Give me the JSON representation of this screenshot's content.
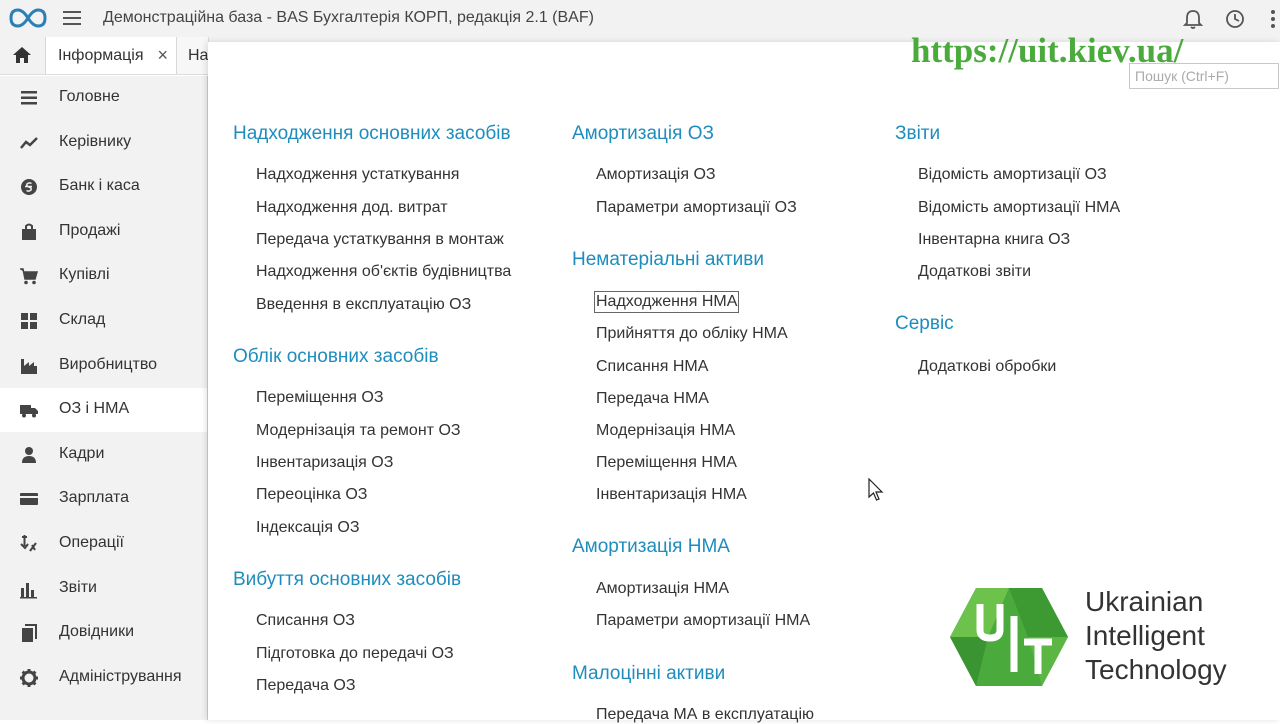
{
  "window": {
    "title": "Демонстраційна база - BAS Бухгалтерія КОРП, редакція 2.1  (BAF)",
    "icons": [
      "app-logo-icon",
      "menu-icon",
      "bell-icon",
      "history-icon",
      "more-vertical-icon"
    ]
  },
  "tabs": [
    {
      "label": "Інформація",
      "close": "×"
    },
    {
      "label": "Надходження"
    }
  ],
  "sidebar": {
    "items": [
      {
        "label": "Головне",
        "icon": "list-icon"
      },
      {
        "label": "Керівнику",
        "icon": "chart-line-icon"
      },
      {
        "label": "Банк і каса",
        "icon": "coin-icon"
      },
      {
        "label": "Продажі",
        "icon": "shopping-bag-icon"
      },
      {
        "label": "Купівлі",
        "icon": "cart-icon"
      },
      {
        "label": "Склад",
        "icon": "warehouse-icon"
      },
      {
        "label": "Виробництво",
        "icon": "factory-icon"
      },
      {
        "label": "ОЗ і НМА",
        "icon": "truck-icon",
        "active": true
      },
      {
        "label": "Кадри",
        "icon": "person-icon"
      },
      {
        "label": "Зарплата",
        "icon": "card-icon"
      },
      {
        "label": "Операції",
        "icon": "operations-icon"
      },
      {
        "label": "Звіти",
        "icon": "bar-chart-icon"
      },
      {
        "label": "Довідники",
        "icon": "books-icon"
      },
      {
        "label": "Адміністрування",
        "icon": "gear-icon"
      }
    ]
  },
  "search": {
    "placeholder": "Пошук (Ctrl+F)"
  },
  "menu": {
    "col1": [
      {
        "title": "Надходження основних засобів",
        "items": [
          "Надходження устаткування",
          "Надходження дод. витрат",
          "Передача устаткування в монтаж",
          "Надходження об'єктів будівництва",
          "Введення в експлуатацію ОЗ"
        ]
      },
      {
        "title": "Облік основних засобів",
        "items": [
          "Переміщення ОЗ",
          "Модернізація та ремонт ОЗ",
          "Інвентаризація ОЗ",
          "Переоцінка ОЗ",
          "Індексація ОЗ"
        ]
      },
      {
        "title": "Вибуття основних засобів",
        "items": [
          "Списання ОЗ",
          "Підготовка до передачі ОЗ",
          "Передача ОЗ"
        ]
      }
    ],
    "col2": [
      {
        "title": "Амортизація ОЗ",
        "items": [
          "Амортизація ОЗ",
          "Параметри амортизації ОЗ"
        ]
      },
      {
        "title": "Нематеріальні активи",
        "items": [
          "Надходження НМА",
          "Прийняття до обліку НМА",
          "Списання НМА",
          "Передача НМА",
          "Модернізація НМА",
          "Переміщення НМА",
          "Інвентаризація НМА"
        ]
      },
      {
        "title": "Амортизація НМА",
        "items": [
          "Амортизація НМА",
          "Параметри амортизації НМА"
        ]
      },
      {
        "title": "Малоцінні активи",
        "items": [
          "Передача МА в експлуатацію"
        ]
      }
    ],
    "col3": [
      {
        "title": "Звіти",
        "items": [
          "Відомість амортизації ОЗ",
          "Відомість амортизації НМА",
          "Інвентарна книга ОЗ",
          "Додаткові звіти"
        ]
      },
      {
        "title": "Сервіс",
        "items": [
          "Додаткові обробки"
        ]
      }
    ]
  },
  "overlay": {
    "url": "https://uit.kiev.ua/",
    "brand_line1": "Ukrainian",
    "brand_line2": "Intelligent",
    "brand_line3": "Technology",
    "logo_letters": "UIT",
    "colors": {
      "brand_green": "#4aaa3c",
      "section_blue": "#1e8dbd"
    }
  }
}
